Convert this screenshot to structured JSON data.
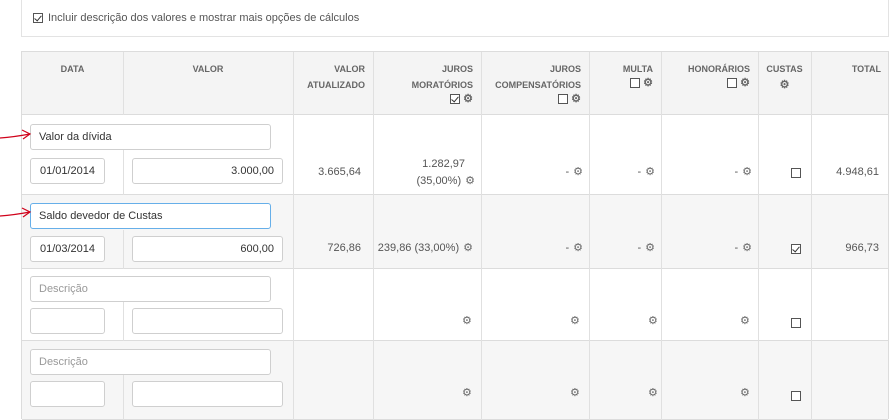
{
  "options": {
    "include_description_label": "Incluir descrição dos valores e mostrar mais opções de cálculos",
    "include_description_checked": true
  },
  "headers": {
    "data": "DATA",
    "valor": "VALOR",
    "valor_atualizado_1": "VALOR",
    "valor_atualizado_2": "ATUALIZADO",
    "juros_moratorios_1": "JUROS",
    "juros_moratorios_2": "MORATÓRIOS",
    "juros_moratorios_checked": true,
    "juros_compensatorios_1": "JUROS",
    "juros_compensatorios_2": "COMPENSATÓRIOS",
    "juros_compensatorios_checked": false,
    "multa": "MULTA",
    "multa_checked": false,
    "honorarios": "HONORÁRIOS",
    "honorarios_checked": false,
    "custas": "CUSTAS",
    "total": "TOTAL"
  },
  "rows": [
    {
      "description": "Valor da dívida",
      "date": "01/01/2014",
      "value": "3.000,00",
      "updated": "3.665,64",
      "juros_mor_1": "1.282,97",
      "juros_mor_2": "(35,00%)",
      "juros_comp": "-",
      "multa": "-",
      "honorarios": "-",
      "custas_checked": false,
      "total": "4.948,61"
    },
    {
      "description": "Saldo devedor de Custas",
      "date": "01/03/2014",
      "value": "600,00",
      "updated": "726,86",
      "juros_mor": "239,86 (33,00%)",
      "juros_comp": "-",
      "multa": "-",
      "honorarios": "-",
      "custas_checked": true,
      "total": "966,73"
    },
    {
      "description_placeholder": "Descrição",
      "custas_checked": false
    },
    {
      "description_placeholder": "Descrição",
      "custas_checked": false
    }
  ],
  "icons": {
    "gear": "gear-icon",
    "annotation_arrow": "red-arrow-icon"
  },
  "colors": {
    "arrow": "#d0021b",
    "focus_border": "#66afe9"
  }
}
